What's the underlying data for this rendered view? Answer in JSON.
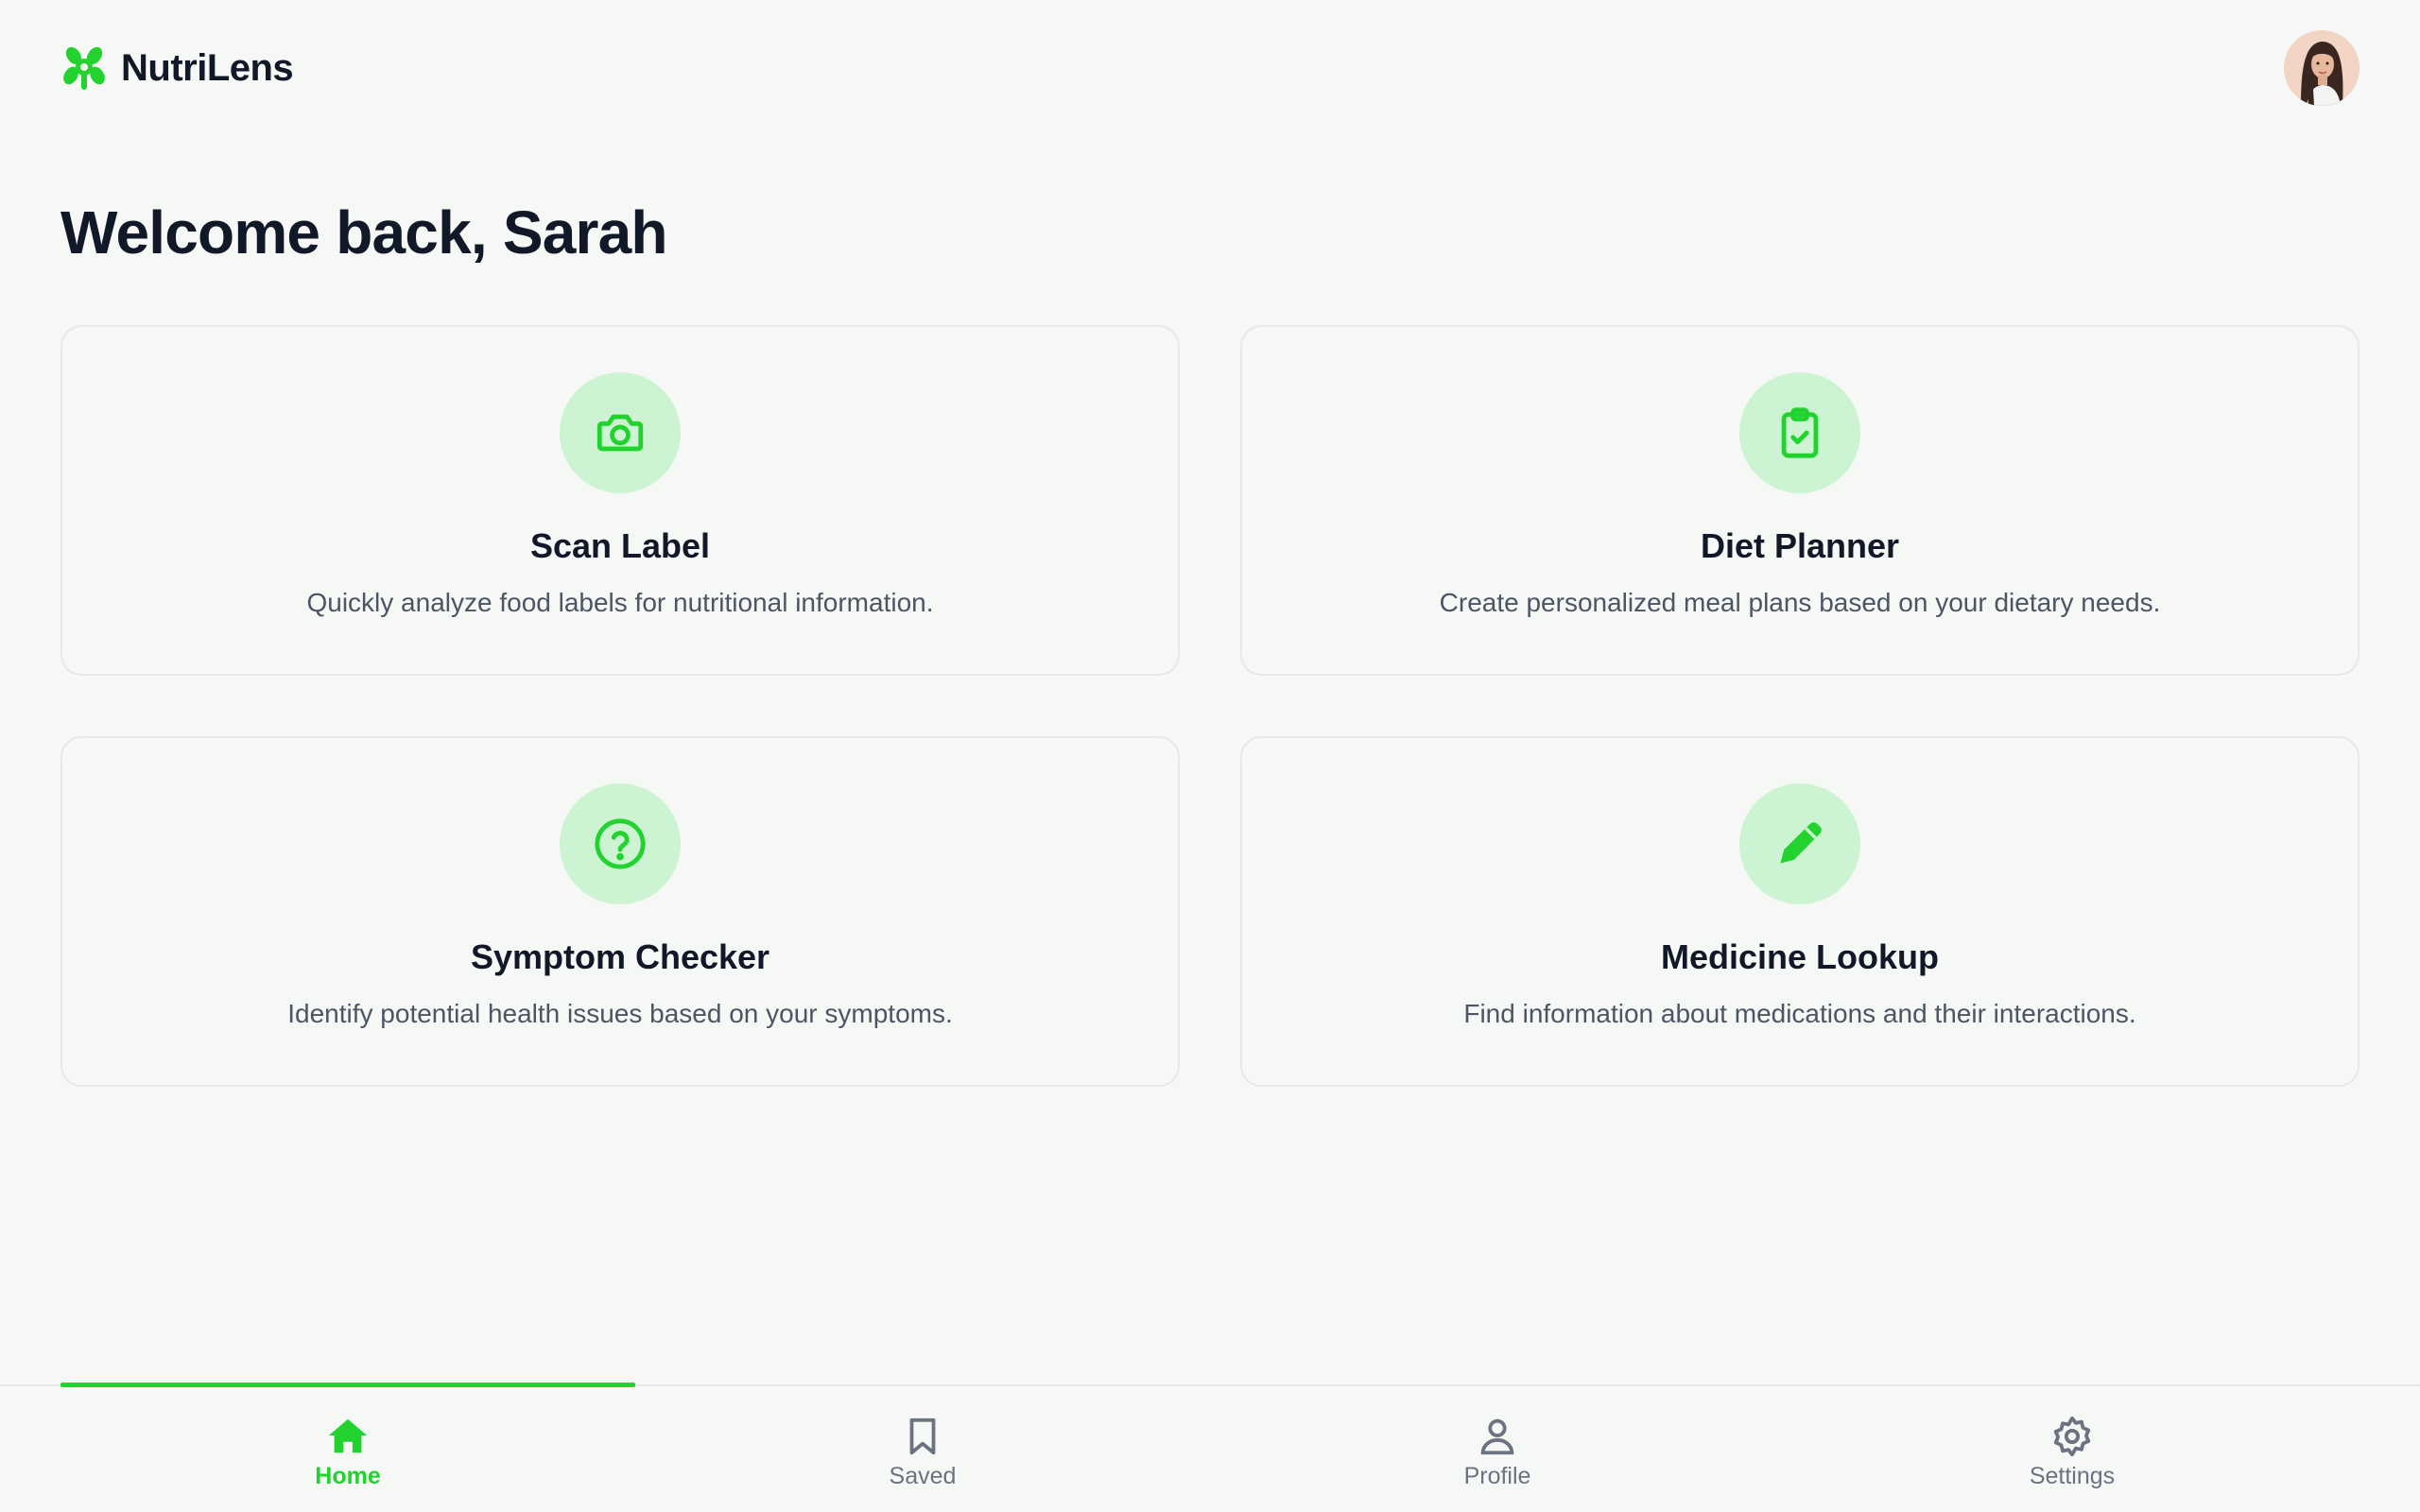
{
  "app": {
    "name": "NutriLens",
    "accent_color": "#22d32f",
    "accent_light": "#cdf4d2"
  },
  "header": {
    "logo_icon": "leaf-cluster-icon",
    "avatar_icon": "user-avatar"
  },
  "welcome": {
    "text": "Welcome back, Sarah"
  },
  "cards": [
    {
      "icon": "camera-icon",
      "title": "Scan Label",
      "description": "Quickly analyze food labels for nutritional information."
    },
    {
      "icon": "clipboard-check-icon",
      "title": "Diet Planner",
      "description": "Create personalized meal plans based on your dietary needs."
    },
    {
      "icon": "question-circle-icon",
      "title": "Symptom Checker",
      "description": "Identify potential health issues based on your symptoms."
    },
    {
      "icon": "pencil-icon",
      "title": "Medicine Lookup",
      "description": "Find information about medications and their interactions."
    }
  ],
  "bottom_nav": {
    "active_index": 0,
    "items": [
      {
        "icon": "home-icon",
        "label": "Home"
      },
      {
        "icon": "bookmark-icon",
        "label": "Saved"
      },
      {
        "icon": "person-icon",
        "label": "Profile"
      },
      {
        "icon": "gear-icon",
        "label": "Settings"
      }
    ]
  }
}
